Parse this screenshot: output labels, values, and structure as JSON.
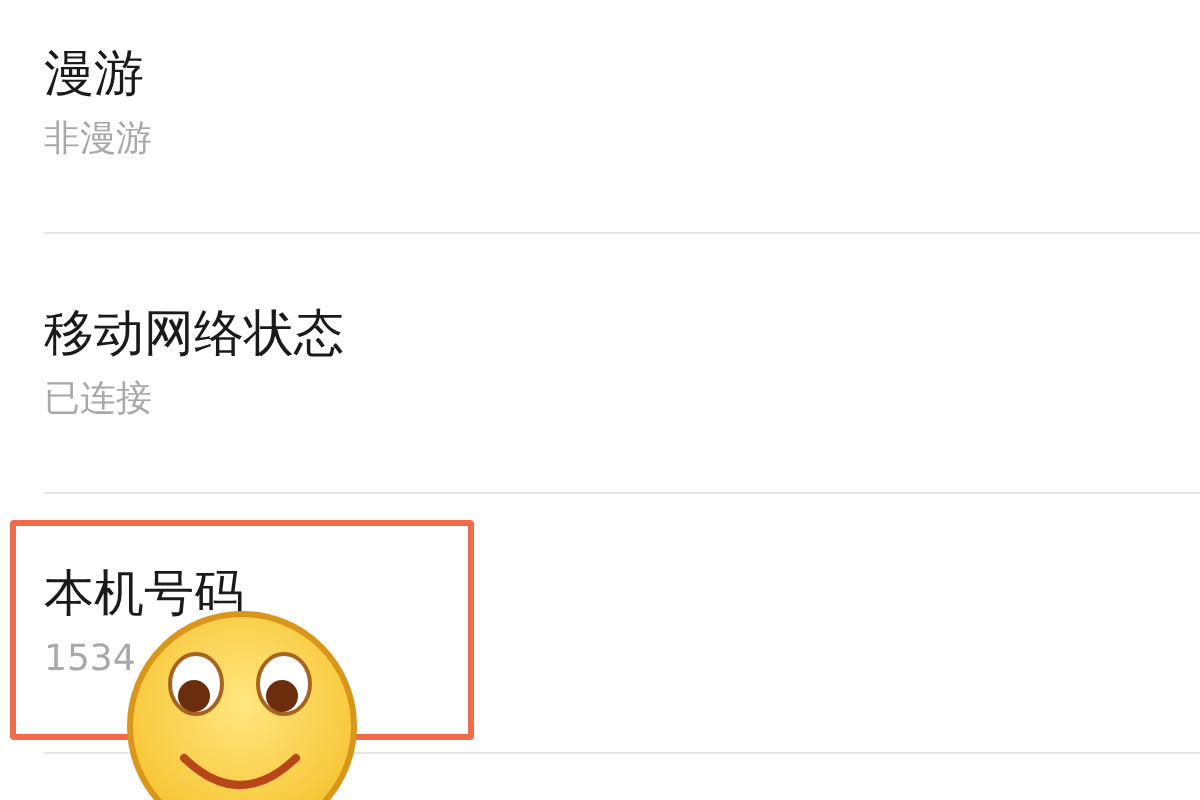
{
  "settings_items": [
    {
      "title": "漫游",
      "value": "非漫游",
      "highlighted": false
    },
    {
      "title": "移动网络状态",
      "value": "已连接",
      "highlighted": false
    },
    {
      "title": "本机号码",
      "value": "1534",
      "highlighted": true
    }
  ]
}
